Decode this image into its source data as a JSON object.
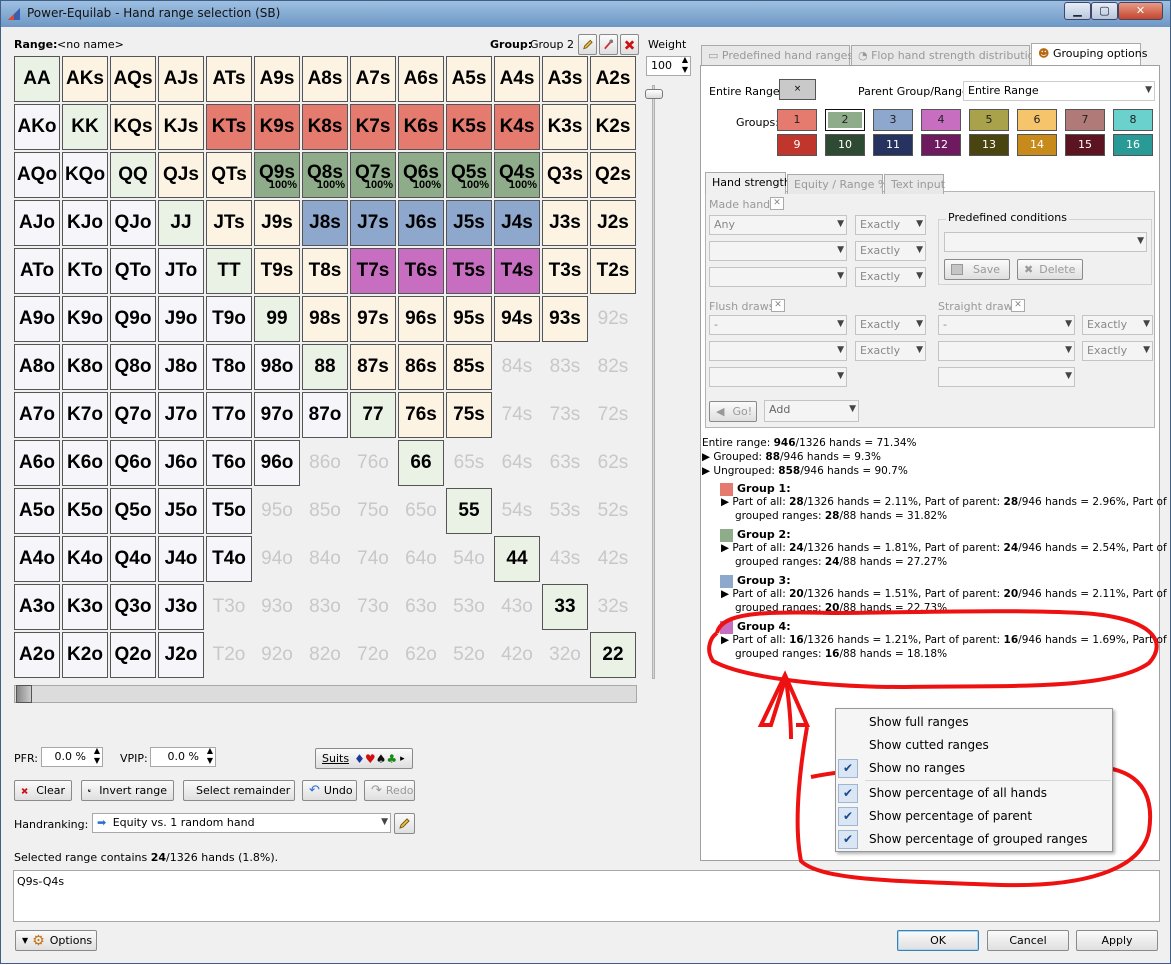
{
  "window": {
    "title": "Power-Equilab - Hand range selection (SB)"
  },
  "top": {
    "range_label": "Range:",
    "range_value": "<no name>",
    "group_label": "Group:",
    "group_value": "Group 2",
    "weight_label": "Weight",
    "weight_value": "100"
  },
  "grid_cells": [
    [
      "AA",
      "AKs",
      "AQs",
      "AJs",
      "ATs",
      "A9s",
      "A8s",
      "A7s",
      "A6s",
      "A5s",
      "A4s",
      "A3s",
      "A2s"
    ],
    [
      "AKo",
      "KK",
      "KQs",
      "KJs",
      "KTs",
      "K9s",
      "K8s",
      "K7s",
      "K6s",
      "K5s",
      "K4s",
      "K3s",
      "K2s"
    ],
    [
      "AQo",
      "KQo",
      "QQ",
      "QJs",
      "QTs",
      "Q9s",
      "Q8s",
      "Q7s",
      "Q6s",
      "Q5s",
      "Q4s",
      "Q3s",
      "Q2s"
    ],
    [
      "AJo",
      "KJo",
      "QJo",
      "JJ",
      "JTs",
      "J9s",
      "J8s",
      "J7s",
      "J6s",
      "J5s",
      "J4s",
      "J3s",
      "J2s"
    ],
    [
      "ATo",
      "KTo",
      "QTo",
      "JTo",
      "TT",
      "T9s",
      "T8s",
      "T7s",
      "T6s",
      "T5s",
      "T4s",
      "T3s",
      "T2s"
    ],
    [
      "A9o",
      "K9o",
      "Q9o",
      "J9o",
      "T9o",
      "99",
      "98s",
      "97s",
      "96s",
      "95s",
      "94s",
      "93s",
      "92s"
    ],
    [
      "A8o",
      "K8o",
      "Q8o",
      "J8o",
      "T8o",
      "98o",
      "88",
      "87s",
      "86s",
      "85s",
      "84s",
      "83s",
      "82s"
    ],
    [
      "A7o",
      "K7o",
      "Q7o",
      "J7o",
      "T7o",
      "97o",
      "87o",
      "77",
      "76s",
      "75s",
      "74s",
      "73s",
      "72s"
    ],
    [
      "A6o",
      "K6o",
      "Q6o",
      "J6o",
      "T6o",
      "96o",
      "86o",
      "76o",
      "66",
      "65s",
      "64s",
      "63s",
      "62s"
    ],
    [
      "A5o",
      "K5o",
      "Q5o",
      "J5o",
      "T5o",
      "95o",
      "85o",
      "75o",
      "65o",
      "55",
      "54s",
      "53s",
      "52s"
    ],
    [
      "A4o",
      "K4o",
      "Q4o",
      "J4o",
      "T4o",
      "94o",
      "84o",
      "74o",
      "64o",
      "54o",
      "44",
      "43s",
      "42s"
    ],
    [
      "A3o",
      "K3o",
      "Q3o",
      "J3o",
      "T3o",
      "93o",
      "83o",
      "73o",
      "63o",
      "53o",
      "43o",
      "33",
      "32s"
    ],
    [
      "A2o",
      "K2o",
      "Q2o",
      "J2o",
      "T2o",
      "92o",
      "82o",
      "72o",
      "62o",
      "52o",
      "42o",
      "32o",
      "22"
    ]
  ],
  "cell_percent_label": "100%",
  "colors": {
    "pair": "#eaf2e6",
    "suited": "#fdf3e3",
    "offsuit": "#f6f6fa",
    "group1": "#e57a6e",
    "group2": "#8fac8a",
    "group3": "#8ea7cc",
    "group4": "#c86ec0"
  },
  "left_bottom": {
    "pfr_label": "PFR:",
    "pfr_value": "0.0 %",
    "vpip_label": "VPIP:",
    "vpip_value": "0.0 %",
    "suits_label": "Suits",
    "clear": "Clear",
    "invert": "Invert range",
    "select_remainder": "Select remainder",
    "undo": "Undo",
    "redo": "Redo",
    "handranking_label": "Handranking:",
    "handranking_value": "Equity vs. 1 random hand",
    "selected_prefix": "Selected range contains ",
    "selected_count": "24",
    "selected_suffix": "/1326 hands (1.8%).",
    "range_text": "Q9s-Q4s"
  },
  "tabs": {
    "predefined": "Predefined hand ranges",
    "flop": "Flop hand strength distribution",
    "grouping": "Grouping options"
  },
  "grouping": {
    "entire_range_label": "Entire Range:",
    "parent_label": "Parent Group/Range:",
    "parent_value": "Entire Range",
    "groups_label": "Groups:",
    "groups": [
      "1",
      "2",
      "3",
      "4",
      "5",
      "6",
      "7",
      "8",
      "9",
      "10",
      "11",
      "12",
      "13",
      "14",
      "15",
      "16"
    ],
    "group_colors": [
      "#e57a6e",
      "#8fac8a",
      "#8ea7cc",
      "#c86ec0",
      "#a9a24a",
      "#f5c46b",
      "#b07a78",
      "#6ad1cc",
      "#c0362c",
      "#2e4a32",
      "#26335f",
      "#6e1a5e",
      "#4a4410",
      "#c88a1a",
      "#5c1420",
      "#2a9a96"
    ]
  },
  "subtabs": {
    "hand_strength": "Hand strength",
    "equity": "Equity / Range %",
    "text_input": "Text input"
  },
  "conditions": {
    "made_hands": "Made hands",
    "any": "Any",
    "exactly": "Exactly",
    "predefined_conditions": "Predefined conditions",
    "save": "Save",
    "delete": "Delete",
    "flush_draws": "Flush draws",
    "straight_draws": "Straight draws",
    "dash": "-",
    "go": "Go!",
    "add": "Add"
  },
  "stats": {
    "entire_pre": "Entire range: ",
    "entire_b": "946",
    "entire_post": "/1326 hands = 71.34%",
    "grouped_pre": "Grouped: ",
    "grouped_b": "88",
    "grouped_post": "/946 hands = 9.3%",
    "ungrouped_pre": "Ungrouped: ",
    "ungrouped_b": "858",
    "ungrouped_post": "/946 hands = 90.7%",
    "part_of_all": "Part of all: ",
    "part_of_parent": ", Part of parent: ",
    "part_of": ", Part of",
    "grouped_ranges": "grouped ranges: ",
    "groups": [
      {
        "title": "Group 1:",
        "all_b": "28",
        "all": "/1326 hands = 2.11%",
        "parent_b": "28",
        "parent": "/946 hands = 2.96%",
        "grp_b": "28",
        "grp": "/88 hands = 31.82%"
      },
      {
        "title": "Group 2:",
        "all_b": "24",
        "all": "/1326 hands = 1.81%",
        "parent_b": "24",
        "parent": "/946 hands = 2.54%",
        "grp_b": "24",
        "grp": "/88 hands = 27.27%"
      },
      {
        "title": "Group 3:",
        "all_b": "20",
        "all": "/1326 hands = 1.51%",
        "parent_b": "20",
        "parent": "/946 hands = 2.11%",
        "grp_b": "20",
        "grp": "/88 hands = 22.73%"
      },
      {
        "title": "Group 4:",
        "all_b": "16",
        "all": "/1326 hands = 1.21%",
        "parent_b": "16",
        "parent": "/946 hands = 1.69%",
        "grp_b": "16",
        "grp": "/88 hands = 18.18%"
      }
    ]
  },
  "context_menu": [
    {
      "label": "Show full ranges",
      "checked": false
    },
    {
      "label": "Show cutted ranges",
      "checked": false
    },
    {
      "label": "Show no ranges",
      "checked": true
    },
    {
      "label": "Show percentage of all hands",
      "checked": true
    },
    {
      "label": "Show percentage of parent",
      "checked": true
    },
    {
      "label": "Show percentage of grouped ranges",
      "checked": true
    }
  ],
  "footer": {
    "options": "Options",
    "ok": "OK",
    "cancel": "Cancel",
    "apply": "Apply"
  },
  "annotation_color": "#ee1111"
}
